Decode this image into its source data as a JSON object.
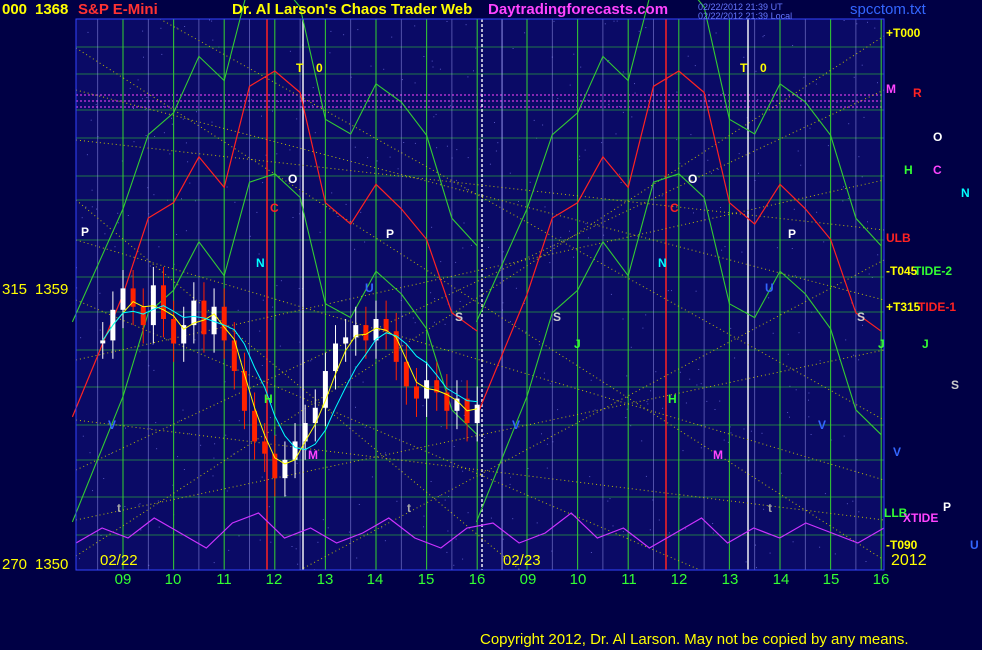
{
  "header": {
    "left_code": "000",
    "left_price": "1368",
    "instrument": "S&P E-Mini",
    "title": "Dr. Al Larson's Chaos Trader Web",
    "site": "Daytradingforecasts.com",
    "stamp1": "02/22/2012 21:39 UT",
    "stamp2": "02/22/2012 21:39 Local",
    "file": "spcctom.txt"
  },
  "y_axis": {
    "mid_code": "315",
    "mid_price": "1359",
    "low_code": "270",
    "low_price": "1350"
  },
  "x_axis": {
    "date1": "02/22",
    "date2": "02/23",
    "year": "2012",
    "hours_day1": [
      "09",
      "10",
      "11",
      "12",
      "13",
      "14",
      "15",
      "16"
    ],
    "hours_day2": [
      "09",
      "10",
      "11",
      "12",
      "13",
      "14",
      "15",
      "16"
    ]
  },
  "right_labels": {
    "t000": "+T000",
    "m": "M",
    "r": "R",
    "o": "O",
    "h": "H",
    "c": "C",
    "n": "N",
    "ulb": "ULB",
    "t045": "-T045",
    "tide2": "TIDE-2",
    "t315": "+T315",
    "tide1": "TIDE-1",
    "j": "J",
    "s": "S",
    "v": "V",
    "llb": "LLB",
    "p": "P",
    "xtide": "XTIDE",
    "t090": "-T090",
    "u": "U"
  },
  "markers": {
    "t": "T",
    "zero": "0",
    "o": "O",
    "c": "C",
    "p": "P",
    "n": "N",
    "u": "U",
    "j": "J",
    "s": "S",
    "h": "H",
    "m": "M",
    "v": "V",
    "t_low": "t"
  },
  "footer": "Copyright 2012, Dr. Al Larson. May not be copied by any means.",
  "colors": {
    "background": "#000045",
    "plot_bg": "#0a0a66",
    "grid": "#33cc33",
    "up_bar": "#ffffff",
    "down_bar": "#ff2200",
    "red_line": "#ff2222",
    "green_line": "#33cc33",
    "xtide": "#cc33ff",
    "diagonal": "#cccc00",
    "magenta_line": "#ff44ff"
  },
  "chart_data": {
    "type": "line",
    "ylim": [
      1350,
      1368
    ],
    "y_ticks": [
      1350,
      1359,
      1368
    ],
    "x_hours_day1": [
      9,
      10,
      11,
      12,
      13,
      14,
      15,
      16
    ],
    "x_hours_day2": [
      9,
      10,
      11,
      12,
      13,
      14,
      15,
      16
    ],
    "price_bars": {
      "hours": [
        8.6,
        8.8,
        9.0,
        9.2,
        9.4,
        9.6,
        9.8,
        10.0,
        10.2,
        10.4,
        10.6,
        10.8,
        11.0,
        11.2,
        11.4,
        11.6,
        11.8,
        12.0,
        12.2,
        12.4,
        12.6,
        12.8,
        13.0,
        13.2,
        13.4,
        13.6,
        13.8,
        14.0,
        14.2,
        14.4,
        14.6,
        14.8,
        15.0,
        15.2,
        15.4,
        15.6,
        15.8,
        16.0
      ],
      "close": [
        1357.5,
        1358.5,
        1359.2,
        1358.6,
        1358.0,
        1359.3,
        1358.2,
        1357.4,
        1358.0,
        1358.8,
        1357.7,
        1358.6,
        1357.5,
        1356.5,
        1355.2,
        1354.2,
        1353.8,
        1353.0,
        1353.6,
        1354.2,
        1354.8,
        1355.3,
        1356.5,
        1357.4,
        1357.6,
        1358.0,
        1357.5,
        1358.2,
        1357.8,
        1356.8,
        1356.0,
        1355.6,
        1356.2,
        1355.8,
        1355.2,
        1355.6,
        1354.8,
        1355.4
      ]
    },
    "projection": {
      "hours": [
        8.0,
        9.0,
        9.5,
        10.0,
        10.5,
        11.0,
        11.5,
        12.0,
        12.5,
        13.0,
        13.5,
        14.0,
        14.5,
        15.0,
        15.5,
        16.0
      ],
      "values": [
        1355.0,
        1359.0,
        1361.5,
        1362.0,
        1363.5,
        1362.5,
        1365.8,
        1366.3,
        1365.6,
        1362.0,
        1361.3,
        1362.6,
        1361.8,
        1360.8,
        1358.4,
        1357.8
      ]
    },
    "xtide": {
      "values": [
        0.3,
        0.6,
        0.4,
        0.8,
        0.5,
        0.2,
        0.7,
        0.9,
        0.4,
        0.6,
        0.3,
        0.5,
        0.8,
        0.4,
        0.2,
        0.6,
        0.7,
        0.3,
        0.5,
        0.9,
        0.4,
        0.6,
        0.2,
        0.5,
        0.8,
        0.3,
        0.6,
        0.4,
        0.7,
        0.5,
        0.3,
        0.6
      ]
    }
  }
}
